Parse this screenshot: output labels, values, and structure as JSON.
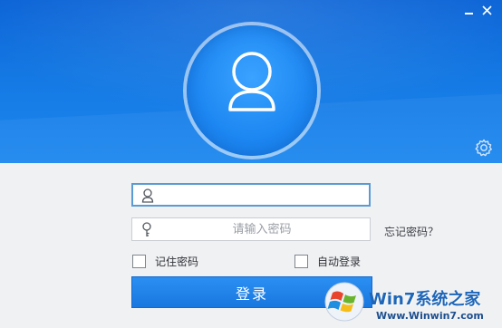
{
  "window": {
    "minimize_icon": "minimize-icon",
    "close_icon": "close-icon"
  },
  "header": {
    "avatar_icon": "user-avatar-icon",
    "settings_icon": "gear-icon",
    "colors": {
      "top": "#0a63d6",
      "bottom": "#1c87ef"
    }
  },
  "form": {
    "username": {
      "value": "",
      "placeholder": "",
      "icon": "user-icon"
    },
    "password": {
      "value": "",
      "placeholder": "请输入密码",
      "icon": "key-icon"
    },
    "forgot_password": "忘记密码？",
    "remember_password": {
      "label": "记住密码",
      "checked": false
    },
    "auto_login": {
      "label": "自动登录",
      "checked": false
    },
    "login_button": "登录",
    "accent": "#1f7ee6"
  },
  "watermark": {
    "title": "Win7系统之家",
    "url": "Www.Winwin7.com",
    "logo": "windows-logo"
  }
}
